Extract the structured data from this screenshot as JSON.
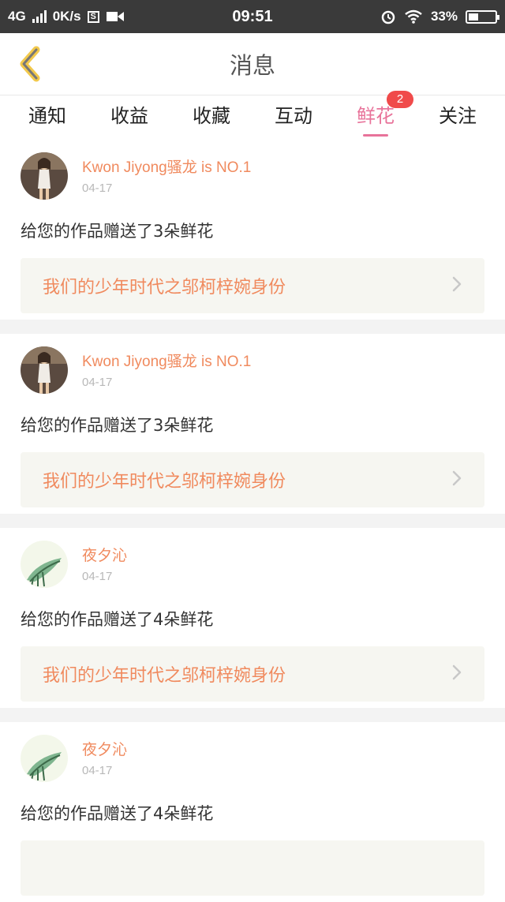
{
  "status_bar": {
    "network": "4G",
    "speed": "0K/s",
    "s_label": "S",
    "time": "09:51",
    "battery_percent": "33%",
    "battery_level": 0.33
  },
  "header": {
    "title": "消息"
  },
  "tabs": [
    {
      "label": "通知",
      "active": false
    },
    {
      "label": "收益",
      "active": false
    },
    {
      "label": "收藏",
      "active": false
    },
    {
      "label": "互动",
      "active": false
    },
    {
      "label": "鲜花",
      "active": true,
      "badge": "2"
    },
    {
      "label": "关注",
      "active": false
    }
  ],
  "colors": {
    "accent_pink": "#e8739a",
    "name_orange": "#f08a5e",
    "badge_red": "#f04a4a"
  },
  "messages": [
    {
      "user": "Kwon Jiyong骚龙 is NO.1",
      "date": "04-17",
      "text": "给您的作品赠送了3朵鲜花",
      "work": "我们的少年时代之邬柯梓婉身份",
      "avatar": "portrait-photo"
    },
    {
      "user": "Kwon Jiyong骚龙 is NO.1",
      "date": "04-17",
      "text": "给您的作品赠送了3朵鲜花",
      "work": "我们的少年时代之邬柯梓婉身份",
      "avatar": "portrait-photo"
    },
    {
      "user": "夜夕沁",
      "date": "04-17",
      "text": "给您的作品赠送了4朵鲜花",
      "work": "我们的少年时代之邬柯梓婉身份",
      "avatar": "leaf-illustration"
    },
    {
      "user": "夜夕沁",
      "date": "04-17",
      "text": "给您的作品赠送了4朵鲜花",
      "work": "",
      "avatar": "leaf-illustration"
    }
  ]
}
